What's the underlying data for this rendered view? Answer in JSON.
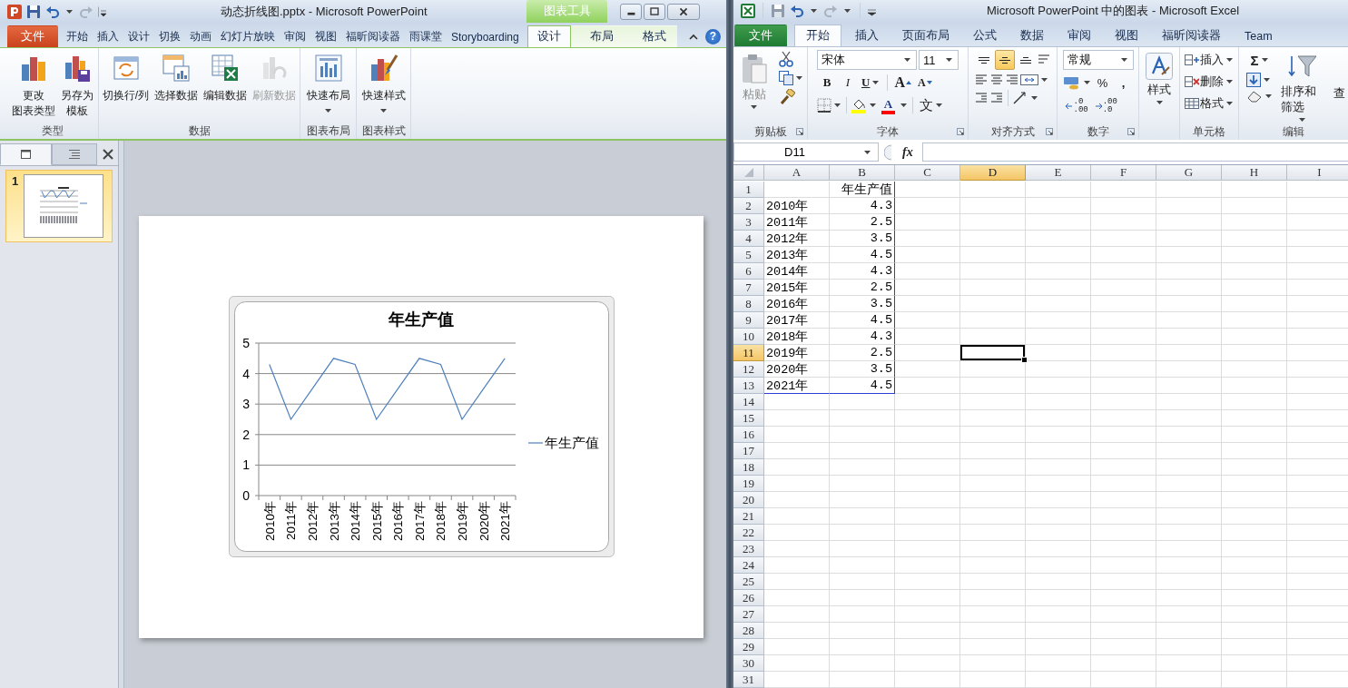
{
  "powerpoint": {
    "title": "动态折线图.pptx - Microsoft PowerPoint",
    "contextual_label": "图表工具",
    "help": "?",
    "tabs": [
      {
        "label": "文件",
        "kind": "file",
        "selected": false
      },
      {
        "label": "开始",
        "kind": "normal",
        "selected": false
      },
      {
        "label": "插入",
        "kind": "normal",
        "selected": false
      },
      {
        "label": "设计",
        "kind": "normal",
        "selected": false
      },
      {
        "label": "切换",
        "kind": "normal",
        "selected": false
      },
      {
        "label": "动画",
        "kind": "normal",
        "selected": false
      },
      {
        "label": "幻灯片放映",
        "kind": "normal",
        "selected": false
      },
      {
        "label": "审阅",
        "kind": "normal",
        "selected": false
      },
      {
        "label": "视图",
        "kind": "normal",
        "selected": false
      },
      {
        "label": "福昕阅读器",
        "kind": "normal",
        "selected": false
      },
      {
        "label": "雨课堂",
        "kind": "normal",
        "selected": false
      },
      {
        "label": "Storyboarding",
        "kind": "normal",
        "selected": false
      },
      {
        "label": "设计",
        "kind": "contextual",
        "selected": true
      },
      {
        "label": "布局",
        "kind": "contextual",
        "selected": false
      },
      {
        "label": "格式",
        "kind": "contextual",
        "selected": false
      }
    ],
    "ribbon_groups": [
      {
        "label": "类型",
        "buttons": [
          {
            "lines": [
              "更改",
              "图表类型"
            ],
            "disabled": false,
            "dropdown": false
          },
          {
            "lines": [
              "另存为",
              "模板"
            ],
            "disabled": false,
            "dropdown": false
          }
        ]
      },
      {
        "label": "数据",
        "buttons": [
          {
            "lines": [
              "切换行/列"
            ],
            "disabled": false,
            "dropdown": false
          },
          {
            "lines": [
              "选择数据"
            ],
            "disabled": false,
            "dropdown": false
          },
          {
            "lines": [
              "编辑数据"
            ],
            "disabled": false,
            "dropdown": false
          },
          {
            "lines": [
              "刷新数据"
            ],
            "disabled": true,
            "dropdown": false
          }
        ]
      },
      {
        "label": "图表布局",
        "buttons": [
          {
            "lines": [
              "快速布局"
            ],
            "disabled": false,
            "dropdown": true
          }
        ]
      },
      {
        "label": "图表样式",
        "buttons": [
          {
            "lines": [
              "快速样式"
            ],
            "disabled": false,
            "dropdown": true
          }
        ]
      }
    ],
    "panel_tabs": [
      {
        "selected": true
      },
      {
        "selected": false
      }
    ],
    "slides": [
      {
        "number": "1",
        "selected": true
      }
    ],
    "chart_data": {
      "type": "line",
      "title": "年生产值",
      "categories": [
        "2010年",
        "2011年",
        "2012年",
        "2013年",
        "2014年",
        "2015年",
        "2016年",
        "2017年",
        "2018年",
        "2019年",
        "2020年",
        "2021年"
      ],
      "series": [
        {
          "name": "年生产值",
          "color": "#4f81bd",
          "values": [
            4.3,
            2.5,
            3.5,
            4.5,
            4.3,
            2.5,
            3.5,
            4.5,
            4.3,
            2.5,
            3.5,
            4.5
          ]
        }
      ],
      "ylim": [
        0,
        5
      ],
      "yticks": [
        0,
        1,
        2,
        3,
        4,
        5
      ],
      "grid": true
    }
  },
  "excel": {
    "title": "Microsoft PowerPoint 中的图表 - Microsoft Excel",
    "tabs": [
      {
        "label": "文件",
        "kind": "file",
        "selected": false
      },
      {
        "label": "开始",
        "kind": "normal",
        "selected": true
      },
      {
        "label": "插入",
        "kind": "normal",
        "selected": false
      },
      {
        "label": "页面布局",
        "kind": "normal",
        "selected": false
      },
      {
        "label": "公式",
        "kind": "normal",
        "selected": false
      },
      {
        "label": "数据",
        "kind": "normal",
        "selected": false
      },
      {
        "label": "审阅",
        "kind": "normal",
        "selected": false
      },
      {
        "label": "视图",
        "kind": "normal",
        "selected": false
      },
      {
        "label": "福昕阅读器",
        "kind": "normal",
        "selected": false
      },
      {
        "label": "Team",
        "kind": "normal",
        "selected": false
      }
    ],
    "clipboard": {
      "label": "剪贴板",
      "launcher": true,
      "paste": "粘贴"
    },
    "font": {
      "label": "字体",
      "launcher": true,
      "name": "宋体",
      "size": "11",
      "bold": "B",
      "italic": "I",
      "underline": "U",
      "grow": "A",
      "shrink": "A",
      "font_color": "A",
      "phonetic": "文"
    },
    "alignment": {
      "label": "对齐方式",
      "launcher": true,
      "vertical": [
        {
          "selected": false
        },
        {
          "selected": true
        },
        {
          "selected": false
        }
      ]
    },
    "number": {
      "label": "数字",
      "launcher": true,
      "format": "常规",
      "percent": "%",
      "comma": ",",
      "increase_decimal": [
        ".0",
        ".00"
      ],
      "decrease_decimal": [
        ".00",
        ".0"
      ]
    },
    "styles": {
      "button": "样式"
    },
    "cells": {
      "label": "单元格",
      "buttons": [
        "插入",
        "删除",
        "格式"
      ]
    },
    "editing": {
      "label": "编辑",
      "sum": "Σ",
      "sort": "排序和筛选",
      "find": "查"
    },
    "name_box": "D11",
    "formula_button": "fx",
    "columns": [
      {
        "label": "A",
        "selected": false
      },
      {
        "label": "B",
        "selected": false
      },
      {
        "label": "C",
        "selected": false
      },
      {
        "label": "D",
        "selected": true
      },
      {
        "label": "E",
        "selected": false
      },
      {
        "label": "F",
        "selected": false
      },
      {
        "label": "G",
        "selected": false
      },
      {
        "label": "H",
        "selected": false
      },
      {
        "label": "I",
        "selected": false
      }
    ],
    "rows": [
      {
        "header": "1",
        "b": "年生产值",
        "selected": false
      },
      {
        "header": "2",
        "a": "2010年",
        "b": "4.3",
        "selected": false
      },
      {
        "header": "3",
        "a": "2011年",
        "b": "2.5",
        "selected": false
      },
      {
        "header": "4",
        "a": "2012年",
        "b": "3.5",
        "selected": false
      },
      {
        "header": "5",
        "a": "2013年",
        "b": "4.5",
        "selected": false
      },
      {
        "header": "6",
        "a": "2014年",
        "b": "4.3",
        "selected": false
      },
      {
        "header": "7",
        "a": "2015年",
        "b": "2.5",
        "selected": false
      },
      {
        "header": "8",
        "a": "2016年",
        "b": "3.5",
        "selected": false
      },
      {
        "header": "9",
        "a": "2017年",
        "b": "4.5",
        "selected": false
      },
      {
        "header": "10",
        "a": "2018年",
        "b": "4.3",
        "selected": false
      },
      {
        "header": "11",
        "a": "2019年",
        "b": "2.5",
        "selected": true
      },
      {
        "header": "12",
        "a": "2020年",
        "b": "3.5",
        "selected": false
      },
      {
        "header": "13",
        "a": "2021年",
        "b": "4.5",
        "selected": false
      },
      {
        "header": "14",
        "selected": false
      },
      {
        "header": "15",
        "selected": false
      },
      {
        "header": "16",
        "selected": false
      },
      {
        "header": "17",
        "selected": false
      },
      {
        "header": "18",
        "selected": false
      },
      {
        "header": "19",
        "selected": false
      },
      {
        "header": "20",
        "selected": false
      },
      {
        "header": "21",
        "selected": false
      },
      {
        "header": "22",
        "selected": false
      },
      {
        "header": "23",
        "selected": false
      },
      {
        "header": "24",
        "selected": false
      },
      {
        "header": "25",
        "selected": false
      },
      {
        "header": "26",
        "selected": false
      },
      {
        "header": "27",
        "selected": false
      },
      {
        "header": "28",
        "selected": false
      },
      {
        "header": "29",
        "selected": false
      },
      {
        "header": "30",
        "selected": false
      },
      {
        "header": "31",
        "selected": false
      }
    ],
    "source_range_outlined": true
  }
}
